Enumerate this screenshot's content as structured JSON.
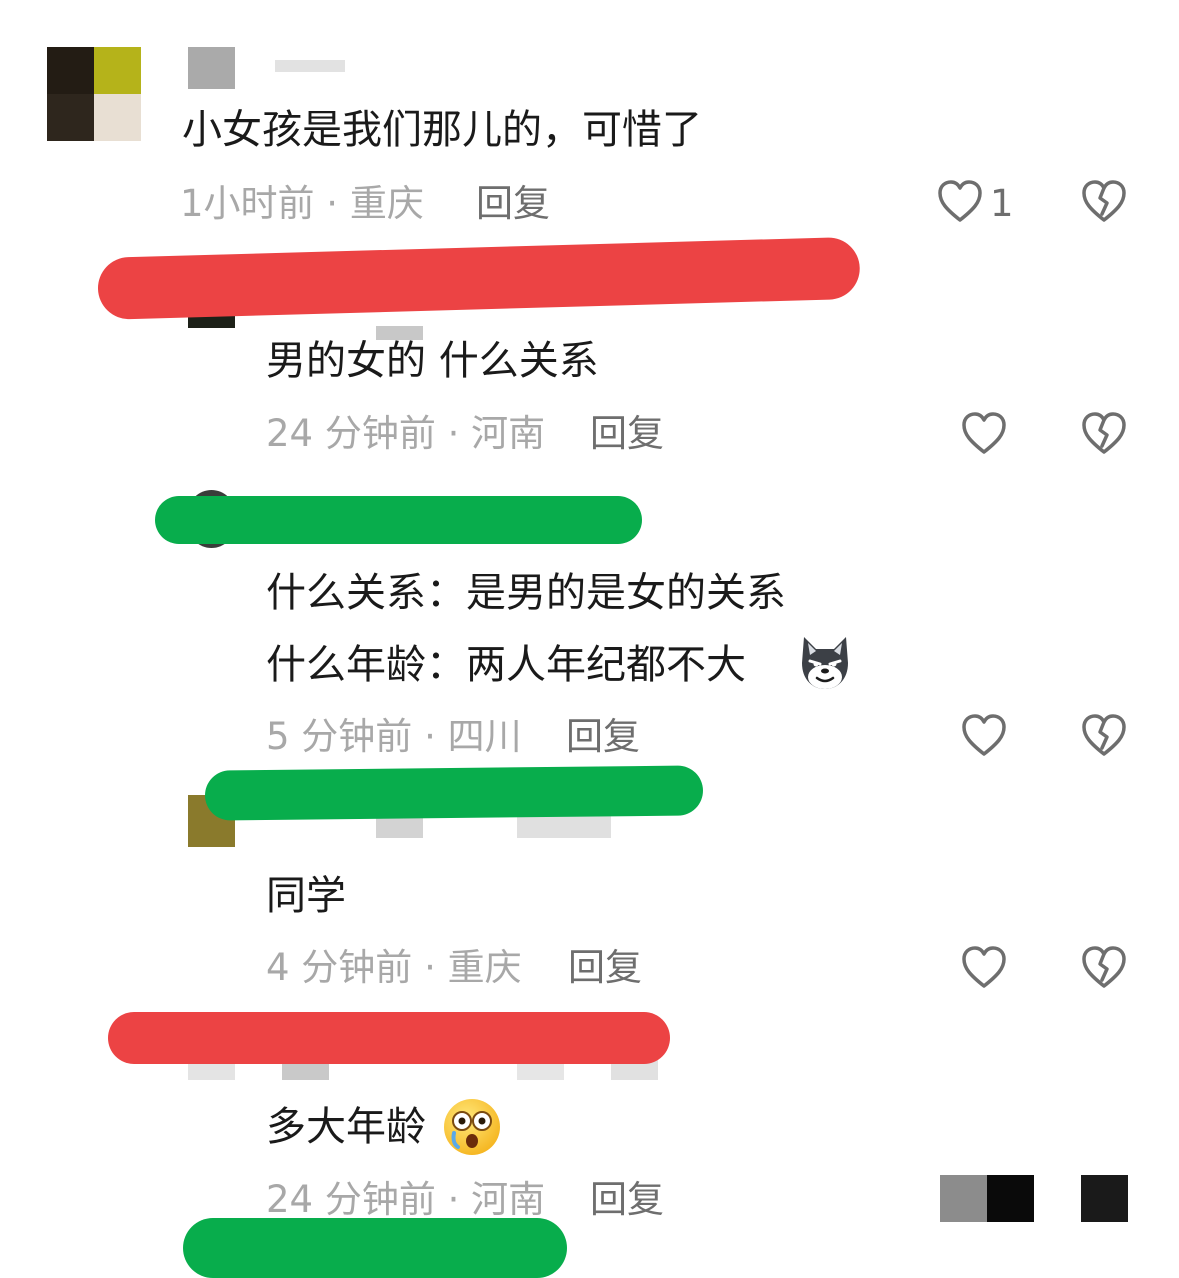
{
  "comments": [
    {
      "text": "小女孩是我们那儿的，可惜了",
      "meta": "1小时前 · 重庆",
      "reply": "回复",
      "likes": "1"
    },
    {
      "text": "男的女的 什么关系",
      "meta": "24 分钟前 · 河南",
      "reply": "回复"
    },
    {
      "line1": "什么关系：是男的是女的关系",
      "line2": "什么年龄：两人年纪都不大",
      "meta": "5 分钟前 · 四川",
      "reply": "回复",
      "emoji": "wolf-emoji"
    },
    {
      "text": "同学",
      "meta": "4 分钟前 · 重庆",
      "reply": "回复"
    },
    {
      "text": "多大年龄",
      "meta": "24 分钟前 · 河南",
      "reply": "回复",
      "emoji": "shocked-face-emoji"
    }
  ],
  "icons": {
    "like": "heart-outline-icon",
    "dislike": "broken-heart-icon"
  },
  "colors": {
    "redaction_red": "#ec4344",
    "redaction_green": "#08ad4c",
    "meta_gray": "#a8a8a8"
  }
}
